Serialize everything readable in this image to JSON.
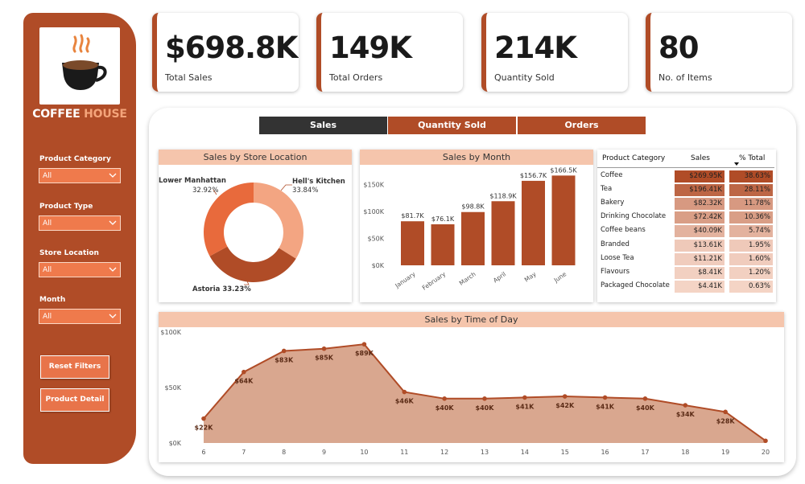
{
  "sidebar": {
    "brand_part1": "COFFEE",
    "brand_part2": "HOUSE",
    "filters": [
      {
        "label": "Product Category",
        "value": "All"
      },
      {
        "label": "Product Type",
        "value": "All"
      },
      {
        "label": "Store Location",
        "value": "All"
      },
      {
        "label": "Month",
        "value": "All"
      }
    ],
    "reset_label": "Reset Filters",
    "detail_label": "Product Detail"
  },
  "kpis": [
    {
      "value": "$698.8K",
      "label": "Total Sales"
    },
    {
      "value": "149K",
      "label": "Total Orders"
    },
    {
      "value": "214K",
      "label": "Quantity Sold"
    },
    {
      "value": "80",
      "label": "No. of Items"
    }
  ],
  "tabs": [
    {
      "label": "Sales",
      "active": true
    },
    {
      "label": "Quantity Sold",
      "active": false
    },
    {
      "label": "Orders",
      "active": false
    }
  ],
  "colors": {
    "brand": "#b04c27",
    "accent_light": "#f5c5ac",
    "tab_active": "#333333",
    "donut": [
      "#f3a582",
      "#b04c27",
      "#e86a3c"
    ]
  },
  "table": {
    "headers": [
      "Product Category",
      "Sales",
      "% Total"
    ],
    "rows": [
      {
        "category": "Coffee",
        "sales": "$269.95K",
        "pct": "38.63%",
        "sales_frac": 1.0,
        "pct_frac": 1.0
      },
      {
        "category": "Tea",
        "sales": "$196.41K",
        "pct": "28.11%",
        "sales_frac": 0.73,
        "pct_frac": 0.73
      },
      {
        "category": "Bakery",
        "sales": "$82.32K",
        "pct": "11.78%",
        "sales_frac": 0.3,
        "pct_frac": 0.3
      },
      {
        "category": "Drinking Chocolate",
        "sales": "$72.42K",
        "pct": "10.36%",
        "sales_frac": 0.27,
        "pct_frac": 0.27
      },
      {
        "category": "Coffee beans",
        "sales": "$40.09K",
        "pct": "5.74%",
        "sales_frac": 0.15,
        "pct_frac": 0.15
      },
      {
        "category": "Branded",
        "sales": "$13.61K",
        "pct": "1.95%",
        "sales_frac": 0.05,
        "pct_frac": 0.05
      },
      {
        "category": "Loose Tea",
        "sales": "$11.21K",
        "pct": "1.60%",
        "sales_frac": 0.04,
        "pct_frac": 0.04
      },
      {
        "category": "Flavours",
        "sales": "$8.41K",
        "pct": "1.20%",
        "sales_frac": 0.03,
        "pct_frac": 0.03
      },
      {
        "category": "Packaged Chocolate",
        "sales": "$4.41K",
        "pct": "0.63%",
        "sales_frac": 0.02,
        "pct_frac": 0.02
      }
    ]
  },
  "chart_data": [
    {
      "type": "pie",
      "title": "Sales by Store Location",
      "categories": [
        "Hell's Kitchen",
        "Astoria",
        "Lower Manhattan"
      ],
      "values": [
        33.84,
        33.23,
        32.92
      ],
      "labels": [
        "Hell's Kitchen 33.84%",
        "Astoria 33.23%",
        "Lower Manhattan 32.92%"
      ]
    },
    {
      "type": "bar",
      "title": "Sales by Month",
      "categories": [
        "January",
        "February",
        "March",
        "April",
        "May",
        "June"
      ],
      "values": [
        81.7,
        76.1,
        98.8,
        118.9,
        156.7,
        166.5
      ],
      "data_labels": [
        "$81.7K",
        "$76.1K",
        "$98.8K",
        "$118.9K",
        "$156.7K",
        "$166.5K"
      ],
      "yticks": [
        "$0K",
        "$50K",
        "$100K",
        "$150K"
      ],
      "ylim": [
        0,
        170
      ]
    },
    {
      "type": "area",
      "title": "Sales by Time of Day",
      "x": [
        6,
        7,
        8,
        9,
        10,
        11,
        12,
        13,
        14,
        15,
        16,
        17,
        18,
        19,
        20
      ],
      "values": [
        22,
        64,
        83,
        85,
        89,
        46,
        40,
        40,
        41,
        42,
        41,
        40,
        34,
        28,
        2
      ],
      "data_labels": [
        "$22K",
        "$64K",
        "$83K",
        "$85K",
        "$89K",
        "$46K",
        "$40K",
        "$40K",
        "$41K",
        "$42K",
        "$41K",
        "$40K",
        "$34K",
        "$28K",
        ""
      ],
      "yticks": [
        "$0K",
        "$50K",
        "$100K"
      ],
      "ylim": [
        0,
        100
      ]
    }
  ]
}
